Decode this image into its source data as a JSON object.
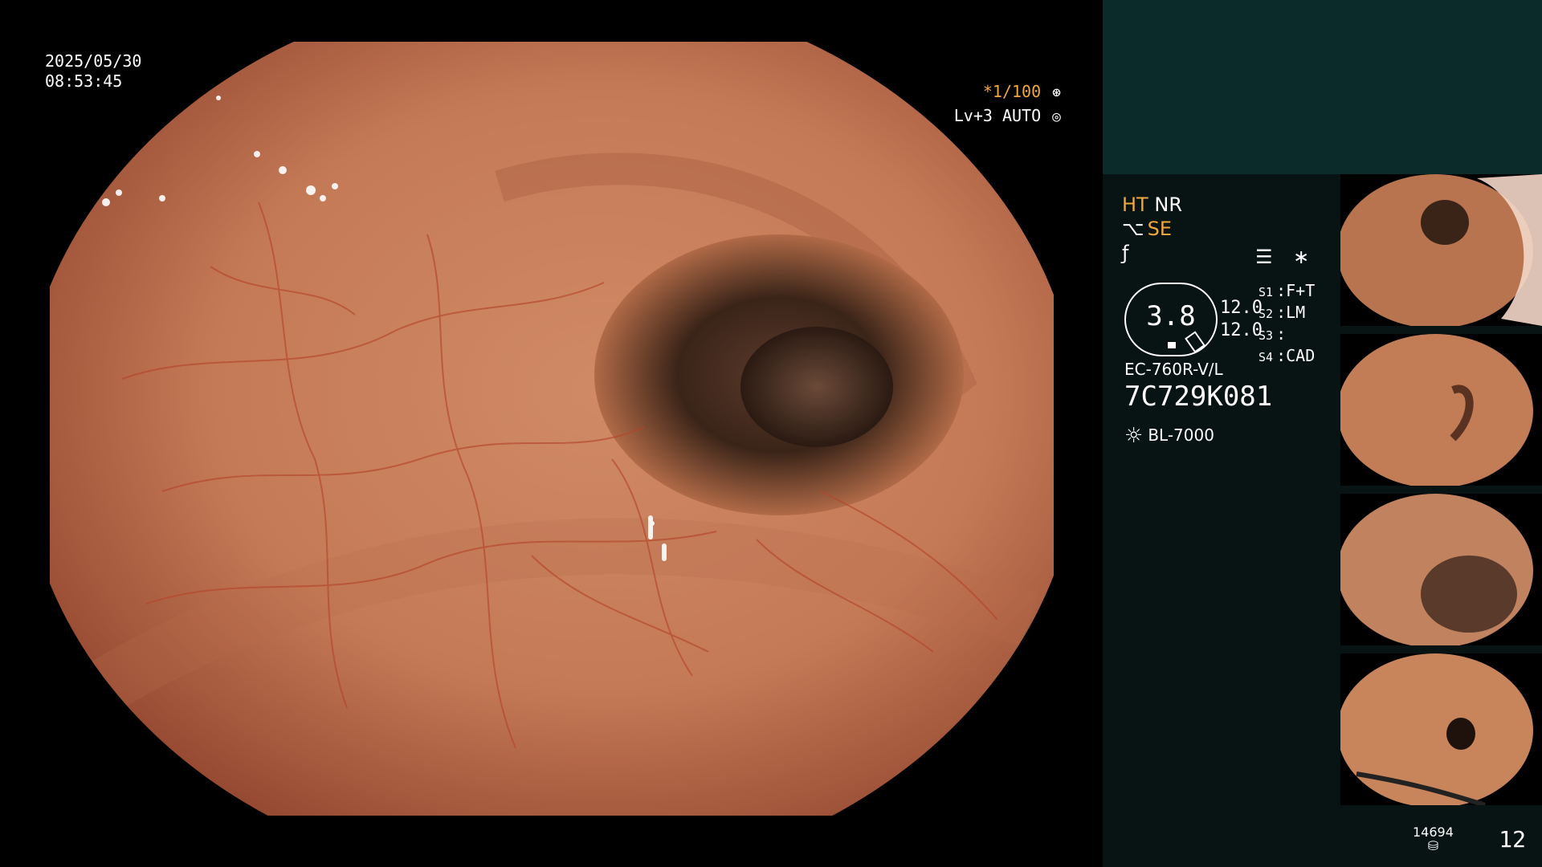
{
  "overlay": {
    "date": "2025/05/30",
    "time": "08:53:45",
    "shutter": "*1/100",
    "shutter_icon": "aperture-icon",
    "level": "Lv+3 AUTO",
    "level_icon": "auto-exposure-icon"
  },
  "panel": {
    "ht": "HT",
    "nr": "NR",
    "se": "SE",
    "se_icon": "enhancement-icon",
    "filter_icon": "filter-icon",
    "menu_icon": "settings-icon",
    "star_icon": "asterisk-icon",
    "meter_value": "3.8",
    "meter_right_1": "12.0",
    "meter_right_2": "12.0",
    "s1": "S1",
    "s1_val": "F+T",
    "s2": "S2",
    "s2_val": "LM",
    "s3": "S3",
    "s3_val": "",
    "s4": "S4",
    "s4_val": "CAD",
    "scope_model": "EC-760R-V/L",
    "scope_serial": "7C729K081",
    "light_source": "BL-7000",
    "light_icon": "sun-icon"
  },
  "footer": {
    "disk_count": "14694",
    "disk_icon": "disk-icon",
    "image_count": "12"
  },
  "colors": {
    "accent": "#f0a83a",
    "panel_bg": "#071413",
    "panel_top": "#0b2b2b"
  }
}
